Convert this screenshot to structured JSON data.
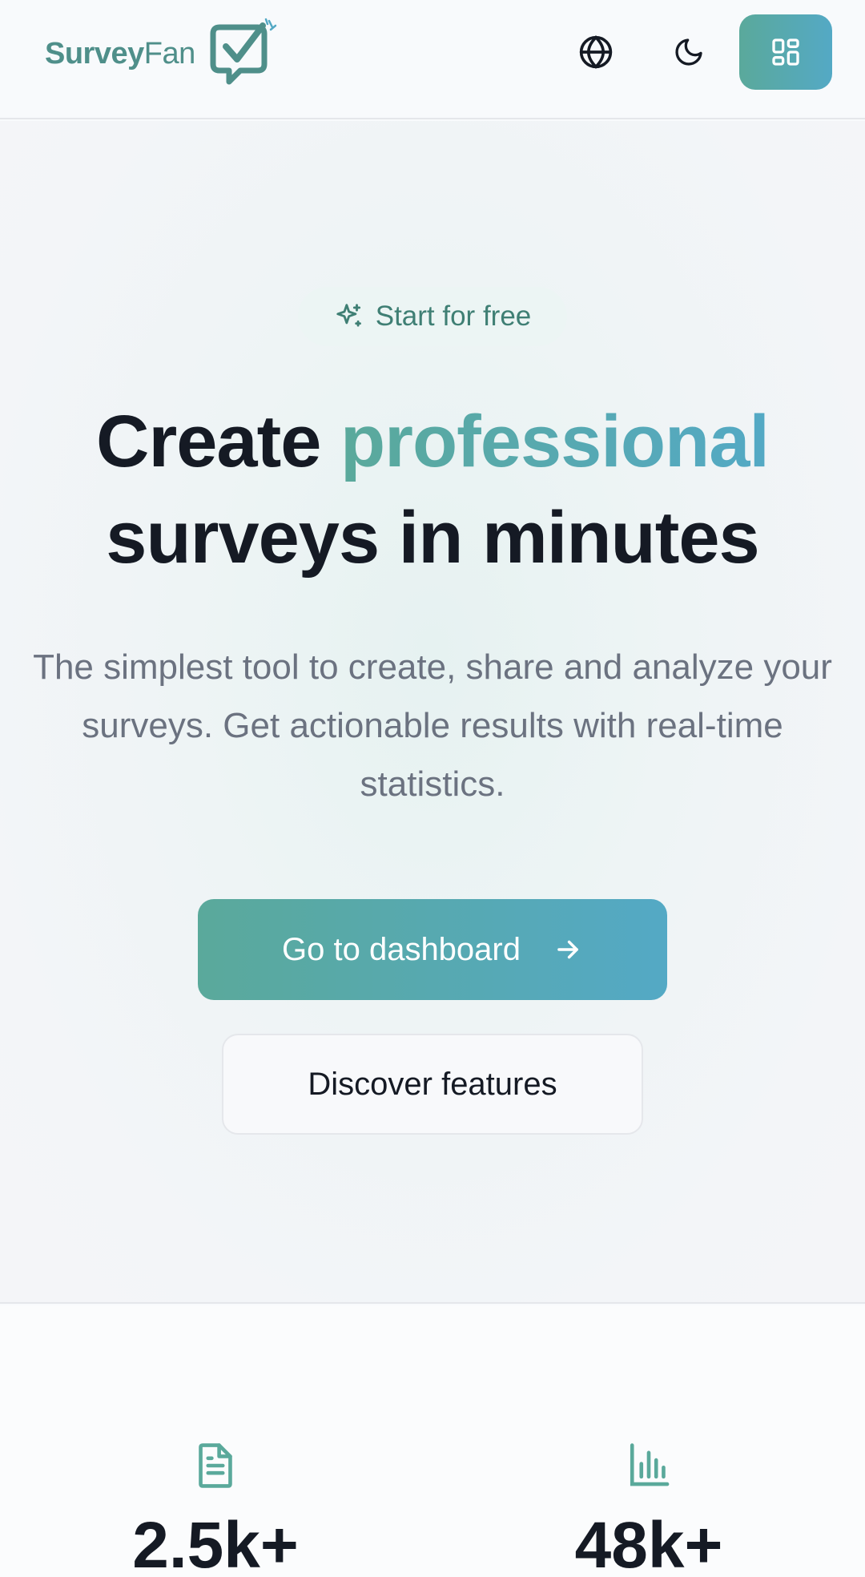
{
  "header": {
    "logo": {
      "part1": "Survey",
      "part2": "Fan"
    },
    "icons": {
      "language": "globe-icon",
      "theme": "moon-icon",
      "dashboard": "grid-icon"
    }
  },
  "hero": {
    "badge": "Start for free",
    "headline": {
      "before": "Create ",
      "accent": "professional",
      "after": "surveys in minutes"
    },
    "subtitle": "The simplest tool to create, share and analyze your surveys. Get actionable results with real-time statistics.",
    "primary_button": "Go to dashboard",
    "secondary_button": "Discover features"
  },
  "stats": [
    {
      "icon": "document-icon",
      "value": "2.5k+"
    },
    {
      "icon": "bar-chart-icon",
      "value": "48k+"
    }
  ],
  "colors": {
    "accent_start": "#5aa99b",
    "accent_end": "#54a9c5",
    "text_dark": "#151a24",
    "text_muted": "#6b7280"
  }
}
